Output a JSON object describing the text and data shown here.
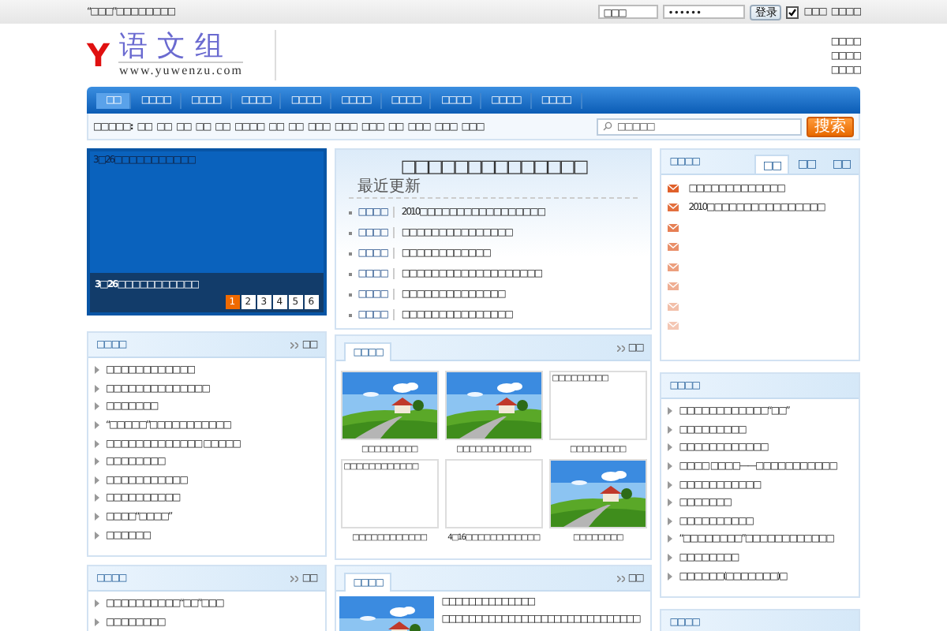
{
  "top_bar": {
    "notice": "“□□□”□□□□□□□□",
    "username": {
      "value": "□□□"
    },
    "password": {
      "value": "••••••"
    },
    "login_button": "登录",
    "remember": {
      "label": "□□□",
      "checked": true
    },
    "link": "□□□□"
  },
  "header": {
    "logo": {
      "mark": "Y",
      "name": "语文组",
      "url": "www.yuwenzu.com"
    },
    "links": [
      "□□□□",
      "□□□□",
      "□□□□"
    ]
  },
  "nav": [
    {
      "label": "□□",
      "selected": true
    },
    {
      "label": "□□□□",
      "selected": false
    },
    {
      "label": "□□□□",
      "selected": false
    },
    {
      "label": "□□□□",
      "selected": false
    },
    {
      "label": "□□□□",
      "selected": false
    },
    {
      "label": "□□□□",
      "selected": false
    },
    {
      "label": "□□□□",
      "selected": false
    },
    {
      "label": "□□□□",
      "selected": false
    },
    {
      "label": "□□□□",
      "selected": false
    },
    {
      "label": "□□□□",
      "selected": false
    }
  ],
  "subnav": {
    "label": "□□□□□:",
    "links": [
      "□□",
      "□□",
      "□□",
      "□□",
      "□□",
      "□□□□",
      "□□",
      "□□",
      "□□□",
      "□□□",
      "□□□",
      "□□",
      "□□□",
      "□□□",
      "□□□"
    ]
  },
  "search": {
    "placeholder": "□□□□□",
    "button": "搜索"
  },
  "slideshow": {
    "top_caption": "3□26□□□□□□□□□□□",
    "caption": "3□26□□□□□□□□□□□",
    "pages": [
      {
        "label": "1",
        "selected": true
      },
      {
        "label": "2",
        "selected": false
      },
      {
        "label": "3",
        "selected": false
      },
      {
        "label": "4",
        "selected": false
      },
      {
        "label": "5",
        "selected": false
      },
      {
        "label": "6",
        "selected": false
      }
    ]
  },
  "news": {
    "title": "□□□□□□□□□□□□□□",
    "subtitle": "最近更新",
    "items": [
      {
        "category": "□□□□",
        "title": "2010□□□□□□□□□□□□□□□□□"
      },
      {
        "category": "□□□□",
        "title": "□□□□□□□□□□□□□□□"
      },
      {
        "category": "□□□□",
        "title": "□□□□□□□□□□□□"
      },
      {
        "category": "□□□□",
        "title": "□□□□□□□□□□□□□□□□□□□"
      },
      {
        "category": "□□□□",
        "title": "□□□□□□□□□□□□□□"
      },
      {
        "category": "□□□□",
        "title": "□□□□□□□□□□□□□□□"
      }
    ]
  },
  "tab_box": {
    "title": "□□□□",
    "tabs": [
      {
        "label": "□□",
        "selected": true
      },
      {
        "label": "□□",
        "selected": false
      },
      {
        "label": "□□",
        "selected": false
      }
    ],
    "items": [
      {
        "kind": "titled",
        "title": "□□□□□□□□□□□□□"
      },
      {
        "kind": "titled",
        "title": "2010□□□□□□□□□□□□□□□□"
      },
      {
        "kind": "blank"
      },
      {
        "kind": "blank"
      },
      {
        "kind": "blank"
      },
      {
        "kind": "blank"
      },
      {
        "kind": "blank"
      },
      {
        "kind": "blank"
      }
    ]
  },
  "left_boxes": [
    {
      "title": "□□□□",
      "more": "□□",
      "items": [
        "□□□□□□□□□□□□",
        "□□□□□□□□□□□□□□",
        "□□□□□□□",
        "“□□□□□”□□□□□□□□□□□",
        "□□□□□□□□□□□□□ □□□□□",
        "□□□□□□□□",
        "□□□□□□□□□□□",
        "□□□□□□□□□□",
        "□□□□“□□□□”",
        "□□□□□□"
      ]
    },
    {
      "title": "□□□□",
      "more": "□□",
      "items": [
        "□□□□□□□□□□“□□”□□□",
        "□□□□□□□□"
      ]
    }
  ],
  "photo_box": {
    "title": "□□□□",
    "more": "□□",
    "photos": [
      {
        "kind": "picture",
        "caption": "□□□□□□□□□"
      },
      {
        "kind": "picture",
        "caption": "□□□□□□□□□□□□"
      },
      {
        "kind": "broken",
        "alt": "□□□□□□□□□",
        "caption": "□□□□□□□□□"
      },
      {
        "kind": "broken",
        "alt": "□□□□□□□□□□□□",
        "caption": "□□□□□□□□□□□□"
      },
      {
        "kind": "broken",
        "caption": "4□16□□□□□□□□□□□□"
      },
      {
        "kind": "picture",
        "caption": "□□□□□□□□"
      }
    ]
  },
  "feature_box": {
    "title": "□□□□",
    "more": "□□",
    "headline": "□□□□□□□□□□□□□□",
    "text": "□□□□□□□□□□□□□□□□□□□□□□□□□□□□□□"
  },
  "right_boxes": [
    {
      "title": "□□□□",
      "items": [
        "□□□□□□□□□□□□“□□”",
        "□□□□□□□□□",
        "□□□□□□□□□□□□",
        "□□□□ □□□□——□□□□□□□□□□□",
        "□□□□□□□□□□□",
        "□□□□□□□",
        "□□□□□□□□□□",
        "“□□□□□□□□”□□□□□□□□□□□□",
        "□□□□□□□□",
        "□□□□□□(□□□□□□□)□"
      ]
    },
    {
      "title": "□□□□"
    }
  ]
}
